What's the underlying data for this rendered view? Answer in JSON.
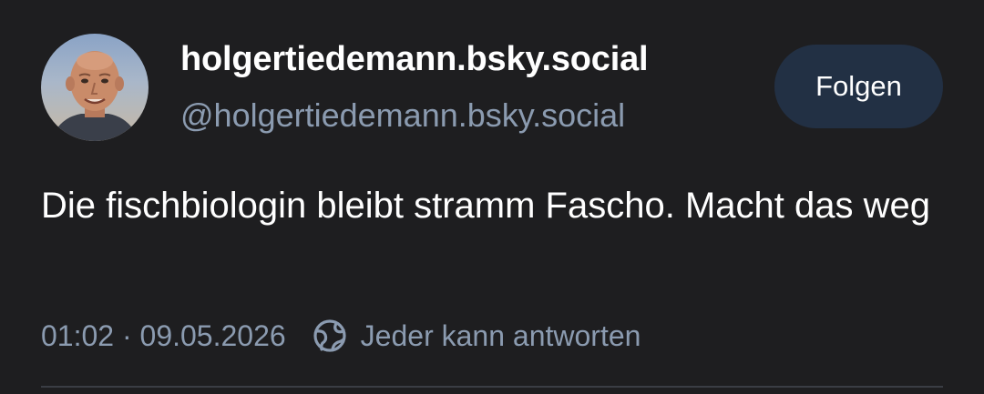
{
  "author": {
    "display_name": "holgertiedemann.bsky.social",
    "handle": "@holgertiedemann.bsky.social",
    "avatar_icon": "person-photo"
  },
  "follow_button": {
    "label": "Folgen"
  },
  "post": {
    "text": "Die fischbiologin bleibt stramm Fascho. Macht das weg",
    "timestamp": "01:02 · 09.05.2026",
    "reply_setting": "Jeder kann antworten",
    "reply_icon": "globe-icon"
  },
  "colors": {
    "background": "#1e1e20",
    "muted_text": "#8b9bb0",
    "button_bg": "#223044"
  }
}
